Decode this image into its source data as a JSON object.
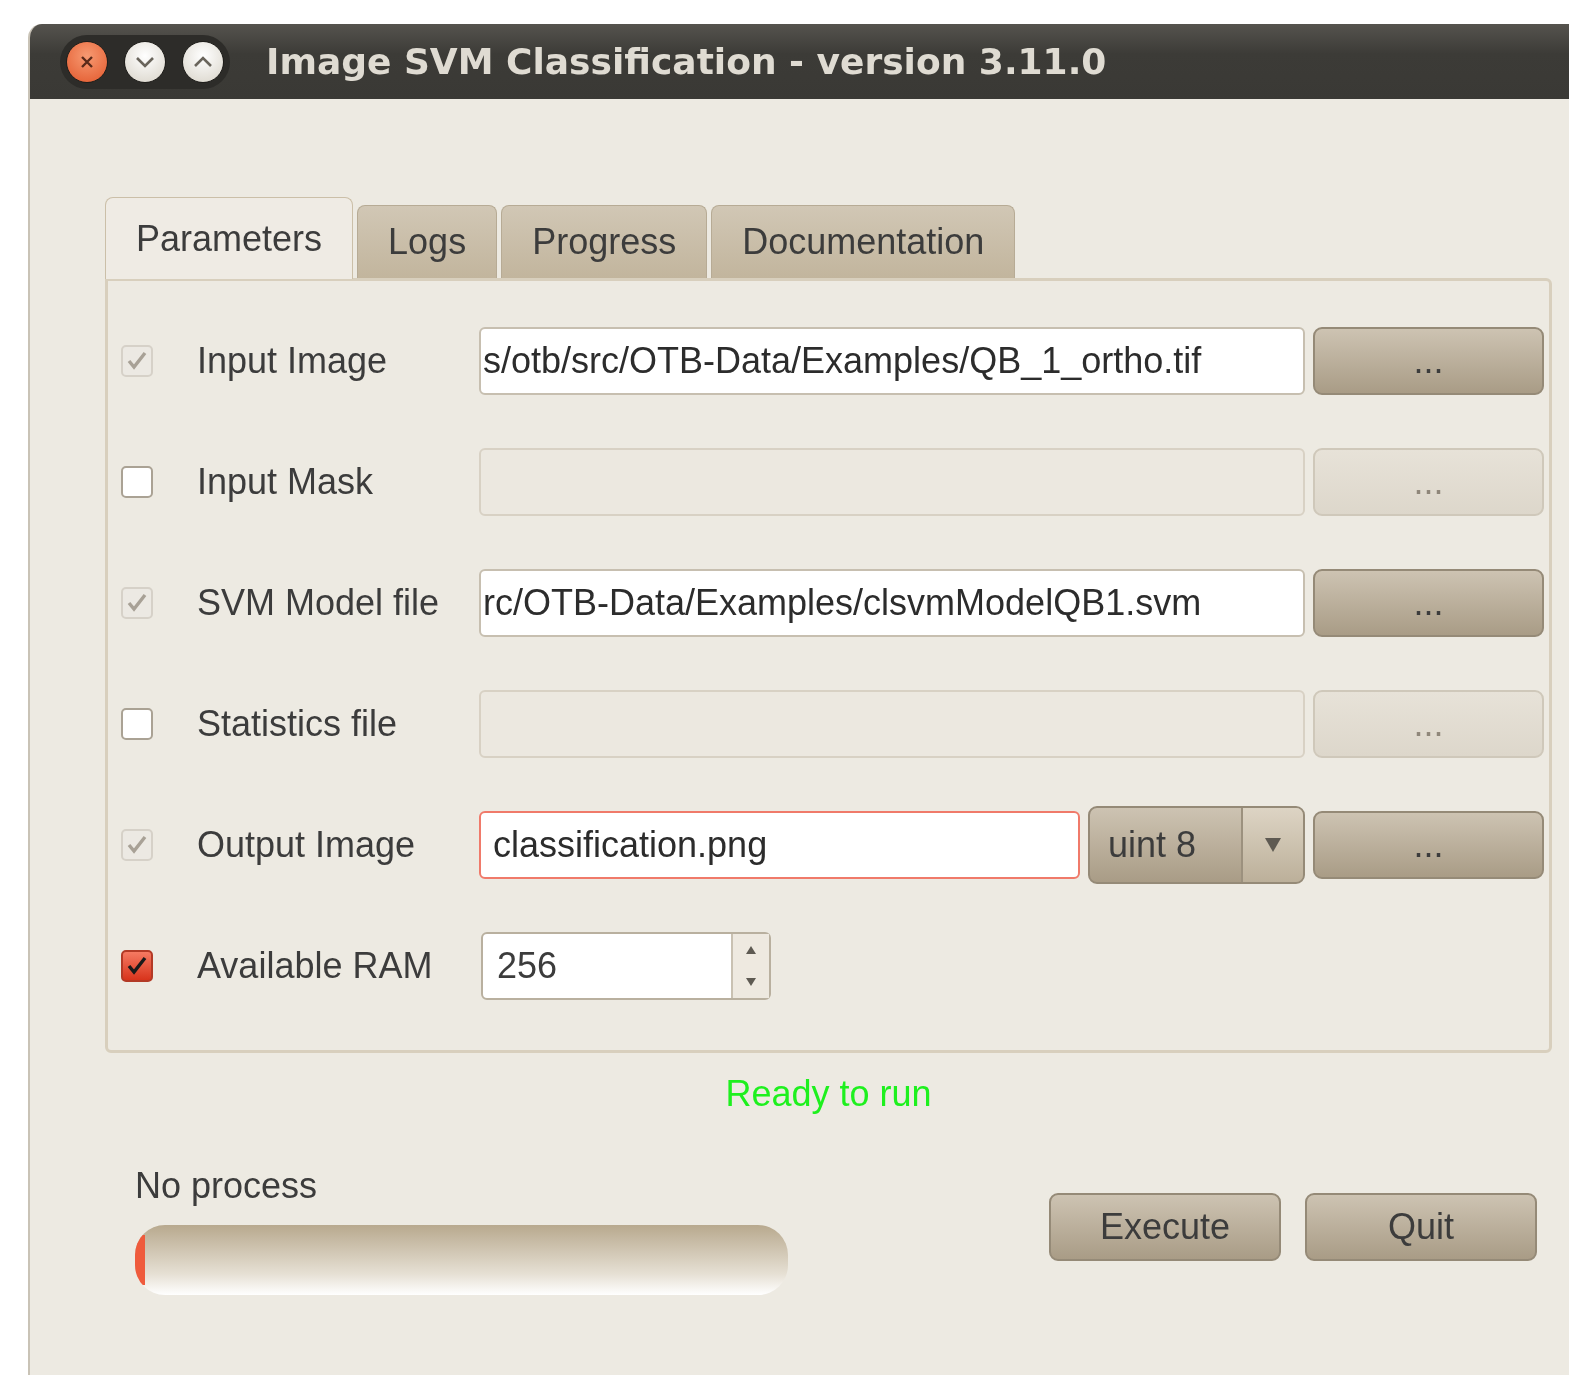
{
  "window": {
    "title": "Image SVM Classification - version 3.11.0"
  },
  "tabs": [
    {
      "label": "Parameters",
      "selected": true
    },
    {
      "label": "Logs",
      "selected": false
    },
    {
      "label": "Progress",
      "selected": false
    },
    {
      "label": "Documentation",
      "selected": false
    }
  ],
  "parameters": [
    {
      "kind": "file",
      "label": "Input Image",
      "checked": true,
      "disabled": true,
      "enabled": true,
      "value": "s/otb/src/OTB-Data/Examples/QB_1_ortho.tif",
      "button": "..."
    },
    {
      "kind": "file",
      "label": "Input Mask",
      "checked": false,
      "disabled": false,
      "enabled": false,
      "button": "..."
    },
    {
      "kind": "file",
      "label": "SVM Model file",
      "checked": true,
      "disabled": true,
      "enabled": true,
      "value": "rc/OTB-Data/Examples/clsvmModelQB1.svm",
      "button": "..."
    },
    {
      "kind": "file",
      "label": "Statistics file",
      "checked": false,
      "disabled": false,
      "enabled": false,
      "button": "..."
    },
    {
      "kind": "output",
      "label": "Output Image",
      "checked": true,
      "disabled": true,
      "enabled": true,
      "error": true,
      "value": "classification.png",
      "type": "uint 8",
      "button": "..."
    },
    {
      "kind": "number",
      "label": "Available RAM",
      "checked": true,
      "disabled": false,
      "enabled": true,
      "value": "256"
    }
  ],
  "status": "Ready to run",
  "progress": {
    "label": "No process",
    "level": 0.015
  },
  "buttons": [
    "Execute",
    "Quit"
  ]
}
